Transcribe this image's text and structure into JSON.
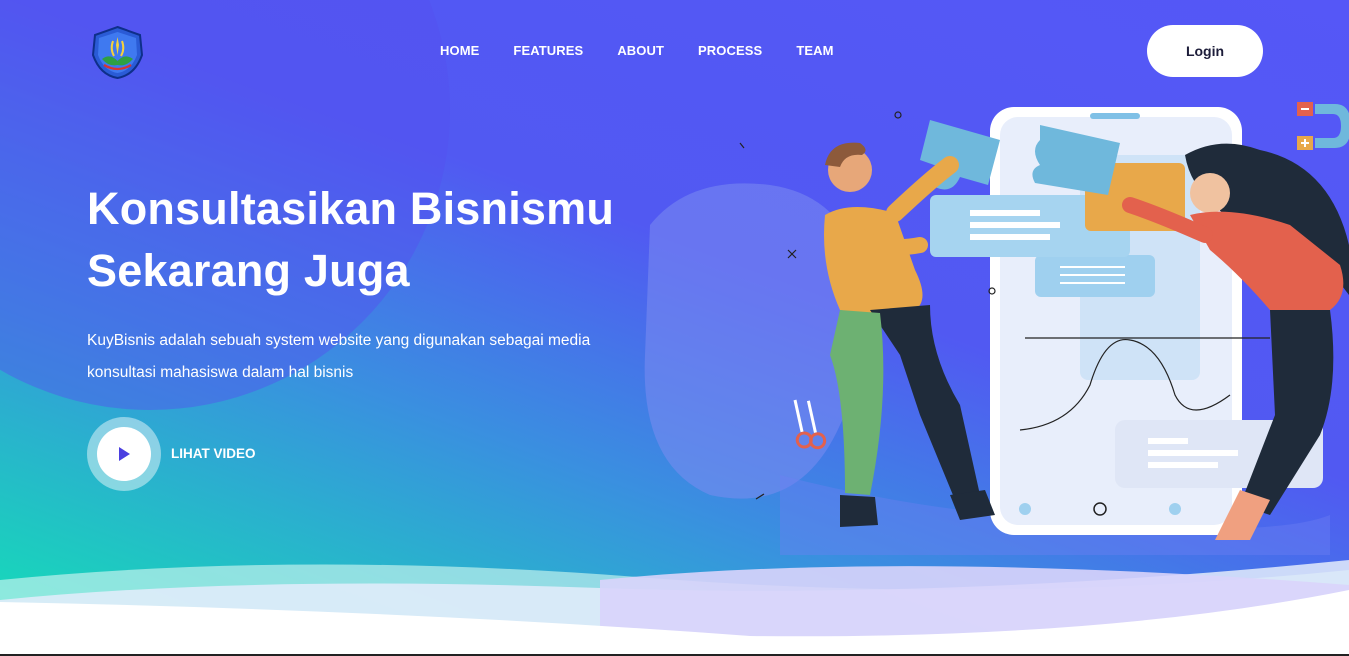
{
  "nav": {
    "items": [
      {
        "label": "HOME"
      },
      {
        "label": "FEATURES"
      },
      {
        "label": "ABOUT"
      },
      {
        "label": "PROCESS"
      },
      {
        "label": "TEAM"
      }
    ],
    "login_label": "Login"
  },
  "hero": {
    "title_line1": "Konsultasikan Bisnismu",
    "title_line2": "Sekarang Juga",
    "description": "KuyBisnis adalah sebuah system website yang digunakan sebagai media konsultasi mahasiswa dalam hal bisnis",
    "video_label": "LIHAT VIDEO"
  },
  "icons": {
    "logo": "university-crest-logo",
    "play": "play-icon",
    "illustration": "teamwork-puzzle-phone-illustration",
    "magnet": "magnet-icon",
    "scissors": "scissors-icon"
  },
  "colors": {
    "gradient_start": "#12e3b6",
    "gradient_mid": "#3a8fe0",
    "gradient_end": "#5557f7",
    "play_triangle": "#4b3fe0",
    "login_text": "#1d1d3a"
  }
}
